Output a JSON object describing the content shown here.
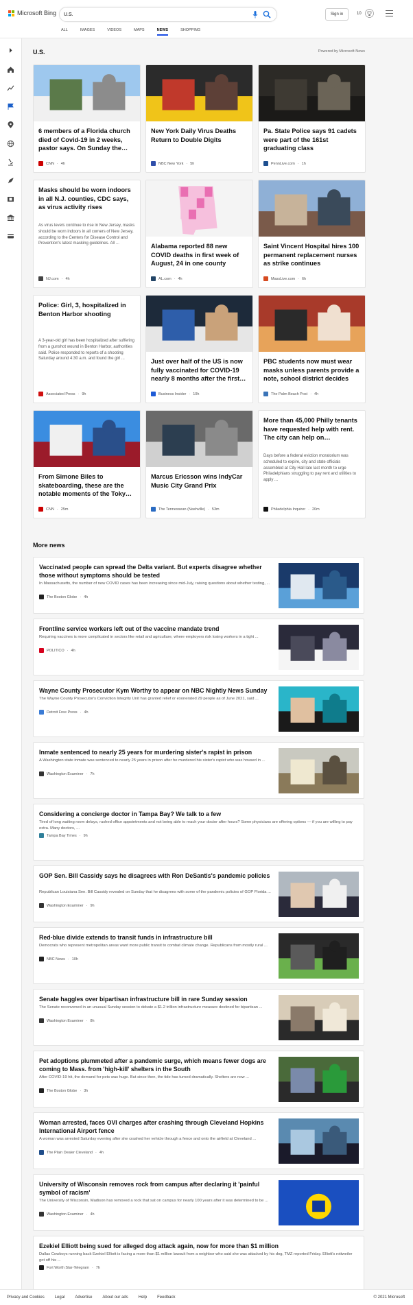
{
  "header": {
    "brand": "Microsoft Bing",
    "search_value": "U.S.",
    "signin_label": "Sign in",
    "reward_count": "10",
    "tabs": [
      {
        "label": "ALL",
        "active": false
      },
      {
        "label": "IMAGES",
        "active": false
      },
      {
        "label": "VIDEOS",
        "active": false
      },
      {
        "label": "MAPS",
        "active": false
      },
      {
        "label": "NEWS",
        "active": true
      },
      {
        "label": "SHOPPING",
        "active": false
      }
    ]
  },
  "sidebar": {
    "icons": [
      "expand-icon",
      "home-icon",
      "trending-icon",
      "flag-icon",
      "location-pin-icon",
      "globe-icon",
      "microscope-icon",
      "rocket-icon",
      "film-icon",
      "bank-icon",
      "car-icon"
    ]
  },
  "main": {
    "section_title": "U.S.",
    "powered_by": "Powered by Microsoft News",
    "cards": [
      {
        "title": "6 members of a Florida church died of Covid-19 in 2 weeks, pastor says. On Sunday the…",
        "desc": "",
        "source": "CNN",
        "time": "4h",
        "source_color": "#cc0000",
        "image": "church-building"
      },
      {
        "title": "New York Daily Virus Deaths Return to Double Digits",
        "desc": "",
        "source": "NBC New York",
        "time": "5h",
        "source_color": "#2f4eaa",
        "image": "protest-crowd"
      },
      {
        "title": "Pa. State Police says 91 cadets were part of the 161st graduating class",
        "desc": "",
        "source": "PennLive.com",
        "time": "1h",
        "source_color": "#1d4f8f",
        "image": "cadets-ceremony"
      },
      {
        "title": "Masks should be worn indoors in all N.J. counties, CDC says, as virus activity rises",
        "desc": "As virus levels continue to rise in New Jersey, masks should be worn indoors in all corners of New Jersey, according to the Centers for Disease Control and Prevention's latest masking guidelines. All ...",
        "source": "NJ.com",
        "time": "4h",
        "source_color": "#444444",
        "image": ""
      },
      {
        "title": "Alabama reported 88 new COVID deaths in first week of August, 24 in one county",
        "desc": "",
        "source": "AL.com",
        "time": "4h",
        "source_color": "#224466",
        "image": "alabama-map"
      },
      {
        "title": "Saint Vincent Hospital hires 100 permanent replacement nurses as strike continues",
        "desc": "",
        "source": "MassLive.com",
        "time": "6h",
        "source_color": "#d64a20",
        "image": "hospital-sign"
      },
      {
        "title": "Police: Girl, 3, hospitalized in Benton Harbor shooting",
        "desc": "A 3-year-old girl has been hospitalized after suffering from a gunshot wound in Benton Harbor, authorities said. Police responded to reports of a shooting Saturday around 4:30 a.m. and found the girl ...",
        "source": "Associated Press",
        "time": "9h",
        "source_color": "#d01010",
        "image": ""
      },
      {
        "title": "Just over half of the US is now fully vaccinated for COVID-19 nearly 8 months after the first…",
        "desc": "",
        "source": "Business Insider",
        "time": "10h",
        "source_color": "#1e5bd6",
        "image": "vaccination"
      },
      {
        "title": "PBC students now must wear masks unless parents provide a note, school district decides",
        "desc": "",
        "source": "The Palm Beach Post",
        "time": "4h",
        "source_color": "#3a74b8",
        "image": "masked-student"
      },
      {
        "title": "From Simone Biles to skateboarding, these are the notable moments of the Toky…",
        "desc": "",
        "source": "CNN",
        "time": "25m",
        "source_color": "#cc0000",
        "image": "gymnast"
      },
      {
        "title": "Marcus Ericsson wins IndyCar Music City Grand Prix",
        "desc": "",
        "source": "The Tennessean (Nashville)",
        "time": "53m",
        "source_color": "#2a6bc2",
        "image": "race-cars"
      },
      {
        "title": "More than 45,000 Philly tenants have requested help with rent. The city can help on…",
        "desc": "Days before a federal eviction moratorium was scheduled to expire, city and state officials assembled at City Hall late last month to urge Philadelphians struggling to pay rent and utilities to apply ...",
        "source": "Philadelphia Inquirer",
        "time": "20m",
        "source_color": "#111111",
        "image": ""
      }
    ]
  },
  "more_news": {
    "title": "More news",
    "items": [
      {
        "title": "Vaccinated people can spread the Delta variant. But experts disagree whether those without symptoms should be tested",
        "desc": "In Massachusetts, the number of new COVID cases has been increasing since mid-July, raising questions about whether testing, ...",
        "source": "The Boston Globe",
        "time": "4h",
        "source_color": "#222222",
        "image": "lab-test"
      },
      {
        "title": "Frontline service workers left out of the vaccine mandate trend",
        "desc": "Requiring vaccines is more complicated in sectors like retail and agriculture, where employers risk losing workers in a tight ...",
        "source": "POLITICO",
        "time": "4h",
        "source_color": "#d6001c",
        "image": "vaccine-sign"
      },
      {
        "title": "Wayne County Prosecutor Kym Worthy to appear on NBC Nightly News Sunday",
        "desc": "The Wayne County Prosecutor's Conviction Integrity Unit has granted relief or exonerated 29 people as of June 2021, said ...",
        "source": "Detroit Free Press",
        "time": "4h",
        "source_color": "#3a7bd5",
        "image": "prosecutor"
      },
      {
        "title": "Inmate sentenced to nearly 25 years for murdering sister's rapist in prison",
        "desc": "A Washington state inmate was sentenced to nearly 25 years in prison after he murdered his sister's rapist who was housed in ...",
        "source": "Washington Examiner",
        "time": "7h",
        "source_color": "#333333",
        "image": "prison-cells"
      },
      {
        "title": "Considering a concierge doctor in Tampa Bay? We talk to a few",
        "desc": "Tired of long waiting room delays, rushed office appointments and not being able to reach your doctor after hours? Some physicians are offering options — if you are willing to pay extra. Many doctors, ...",
        "source": "Tampa Bay Times",
        "time": "9h",
        "source_color": "#2f7f9a",
        "image": ""
      },
      {
        "title": "GOP Sen. Bill Cassidy says he disagrees with Ron DeSantis's pandemic policies",
        "desc": "Republican Louisiana Sen. Bill Cassidy revealed on Sunday that he disagrees with some of the pandemic policies of GOP Florida ...",
        "source": "Washington Examiner",
        "time": "9h",
        "source_color": "#333333",
        "image": "senator"
      },
      {
        "title": "Red-blue divide extends to transit funds in infrastructure bill",
        "desc": "Democrats who represent metropolitan areas want more public transit to combat climate change. Republicans from mostly rural ...",
        "source": "NBC News",
        "time": "10h",
        "source_color": "#222222",
        "image": "transit-workers"
      },
      {
        "title": "Senate haggles over bipartisan infrastructure bill in rare Sunday session",
        "desc": "The Senate reconvened in an unusual Sunday session to debate a $1.2 trillion infrastructure measure destined for bipartisan ...",
        "source": "Washington Examiner",
        "time": "8h",
        "source_color": "#333333",
        "image": "senate-hall"
      },
      {
        "title": "Pet adoptions plummeted after a pandemic surge, which means fewer dogs are coming to Mass. from 'high-kill' shelters in the South",
        "desc": "After COVID-19 hit, the demand for pets was huge. But since then, the tide has turned dramatically. Shelters are now ...",
        "source": "The Boston Globe",
        "time": "3h",
        "source_color": "#222222",
        "image": "dog"
      },
      {
        "title": "Woman arrested, faces OVI charges after crashing through Cleveland Hopkins International Airport fence",
        "desc": "A woman was arrested Saturday evening after she crashed her vehicle through a fence and onto the airfield at Cleveland ...",
        "source": "The Plain Dealer Cleveland",
        "time": "4h",
        "source_color": "#1f4d8a",
        "image": "airplane"
      },
      {
        "title": "University of Wisconsin removes rock from campus after declaring it 'painful symbol of racism'",
        "desc": "The University of Wisconsin, Madison has removed a rock that sat on campus for nearly 100 years after it was determined to be ...",
        "source": "Washington Examiner",
        "time": "4h",
        "source_color": "#333333",
        "image": "wisconsin-flag"
      },
      {
        "title": "Ezekiel Elliott being sued for alleged dog attack again, now for more than $1 million",
        "desc": "Dallas Cowboys running back Ezekiel Elliott is facing a more than $1 million lawsuit from a neighbor who said she was attacked by his dog, TMZ reported Friday. Elliott's rottweiler got off his ...",
        "source": "Fort Worth Star-Telegram",
        "time": "7h",
        "source_color": "#1c1c1c",
        "image": ""
      }
    ]
  },
  "footer": {
    "links": [
      "Privacy and Cookies",
      "Legal",
      "Advertise",
      "About our ads",
      "Help",
      "Feedback"
    ],
    "copyright": "© 2021 Microsoft"
  }
}
